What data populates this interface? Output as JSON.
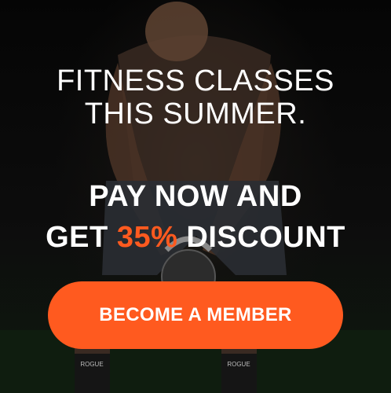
{
  "banner": {
    "headline_line1": "FITNESS CLASSES",
    "headline_line2": "THIS SUMMER.",
    "offer_line1": "PAY NOW AND",
    "offer_line2_prefix": "GET ",
    "offer_discount": "35%",
    "offer_line2_suffix": " DISCOUNT",
    "cta_label": "BECOME A MEMBER",
    "sock_text": "ROGUE"
  },
  "colors": {
    "accent": "#ff5a1f",
    "text": "#ffffff",
    "background": "#0b0b0b"
  },
  "icons": [
    "kettlebell-icon"
  ]
}
